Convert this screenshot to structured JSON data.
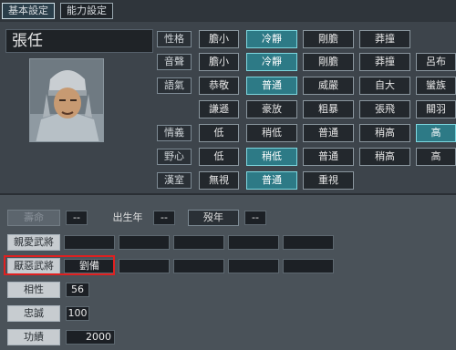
{
  "tabs": {
    "basic": "基本設定",
    "ability": "能力設定"
  },
  "name": "張任",
  "rows": {
    "personality": {
      "label": "性格",
      "options": [
        "膽小",
        "冷靜",
        "剛膽",
        "莽撞"
      ],
      "selected": 1
    },
    "voice": {
      "label": "音聲",
      "options": [
        "膽小",
        "冷靜",
        "剛膽",
        "莽撞",
        "呂布"
      ],
      "selected": 1
    },
    "tone": {
      "label": "語氣",
      "options": [
        "恭敬",
        "普通",
        "威嚴",
        "自大",
        "蠻族"
      ],
      "selected": 1
    },
    "tone2": {
      "options": [
        "謙遜",
        "豪放",
        "粗暴",
        "張飛",
        "關羽"
      ]
    },
    "loyalty": {
      "label": "情義",
      "options": [
        "低",
        "稍低",
        "普通",
        "稍高",
        "高"
      ],
      "selected": 4
    },
    "ambition": {
      "label": "野心",
      "options": [
        "低",
        "稍低",
        "普通",
        "稍高",
        "高"
      ],
      "selected": 1
    },
    "han": {
      "label": "漢室",
      "options": [
        "無視",
        "普通",
        "重視"
      ],
      "selected": 1
    }
  },
  "lower": {
    "lifespan_label": "壽命",
    "lifespan_value": "--",
    "birth_label": "出生年",
    "birth_value": "--",
    "death_label": "歿年",
    "death_value": "--",
    "favorite_label": "親愛武將",
    "hated_label": "厭惡武將",
    "hated_value": "劉備",
    "compat_label": "相性",
    "compat_value": "56",
    "loyalty_label": "忠誠",
    "loyalty_value": "100",
    "merit_label": "功績",
    "merit_value": "2000"
  }
}
